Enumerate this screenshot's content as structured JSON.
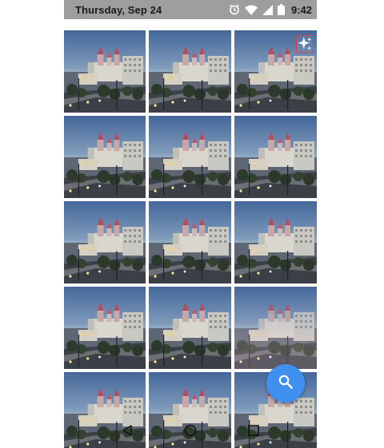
{
  "status_bar": {
    "date": "Thursday, Sep 24",
    "time": "9:42",
    "icons": [
      "alarm-icon",
      "wifi-icon",
      "signal-icon",
      "battery-icon"
    ]
  },
  "gallery": {
    "photo_count": 15,
    "highlighted_photo_index": 2,
    "highlight_icon": "sparkle-icon",
    "highlight_color": "#d0445a"
  },
  "fab": {
    "icon": "search-icon",
    "color": "#3f8ff0"
  },
  "nav_bar": {
    "icons": [
      "back-icon",
      "home-icon",
      "recents-icon"
    ]
  },
  "colors": {
    "status_bar_bg": "#9e9e9e",
    "sky_top": "#4a6fa0",
    "sky_bottom": "#c9d4dc"
  }
}
